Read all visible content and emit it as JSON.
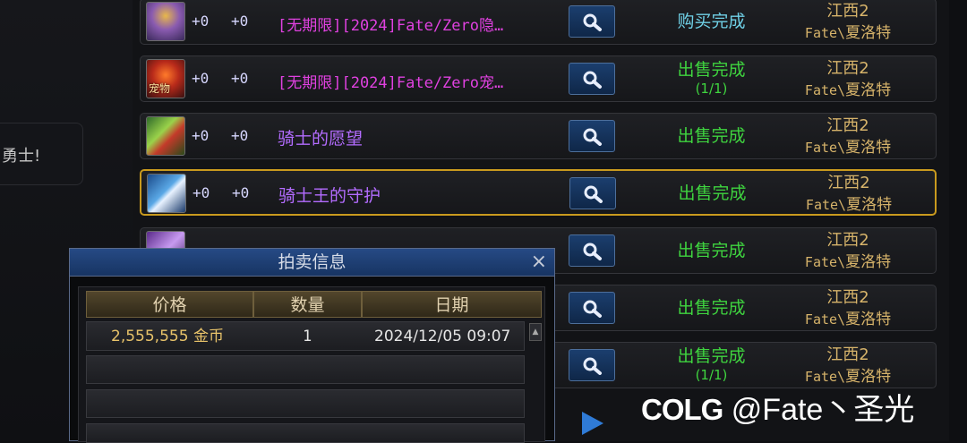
{
  "left_hint": "勇士!",
  "rows": [
    {
      "plus1": "+0",
      "plus2": "+0",
      "name": "[无期限][2024]Fate/Zero隐…",
      "status": "购买完成",
      "status_sub": "",
      "server": "江西2",
      "seller_en": "Fate\\",
      "seller_cn": "夏洛特"
    },
    {
      "plus1": "+0",
      "plus2": "+0",
      "name": "[无期限][2024]Fate/Zero宠…",
      "status": "出售完成",
      "status_sub": "(1/1)",
      "server": "江西2",
      "seller_en": "Fate\\",
      "seller_cn": "夏洛特",
      "icon_tag": "宠物"
    },
    {
      "plus1": "+0",
      "plus2": "+0",
      "name": "骑士的愿望",
      "status": "出售完成",
      "status_sub": "",
      "server": "江西2",
      "seller_en": "Fate\\",
      "seller_cn": "夏洛特"
    },
    {
      "plus1": "+0",
      "plus2": "+0",
      "name": "骑士王的守护",
      "status": "出售完成",
      "status_sub": "",
      "server": "江西2",
      "seller_en": "Fate\\",
      "seller_cn": "夏洛特"
    },
    {
      "status": "出售完成",
      "status_sub": "",
      "server": "江西2",
      "seller_en": "Fate\\",
      "seller_cn": "夏洛特"
    },
    {
      "status": "出售完成",
      "status_sub": "",
      "server": "江西2",
      "seller_en": "Fate\\",
      "seller_cn": "夏洛特"
    },
    {
      "status": "出售完成",
      "status_sub": "(1/1)",
      "server": "江西2",
      "seller_en": "Fate\\",
      "seller_cn": "夏洛特"
    }
  ],
  "popup": {
    "title": "拍卖信息",
    "close": "×",
    "headers": {
      "price": "价格",
      "qty": "数量",
      "date": "日期"
    },
    "record": {
      "price": "2,555,555",
      "currency": "金币",
      "qty": "1",
      "date": "2024/12/05 09:07"
    }
  },
  "watermark": {
    "logo": "COLG",
    "handle": "@Fate丶圣光"
  },
  "colors": {
    "rare_name": "#e041e0",
    "magic_name": "#b36cff",
    "sold": "#3fd43f",
    "bought": "#6fd0e6",
    "server": "#d6b36a",
    "selected_border": "#c99a1e"
  }
}
